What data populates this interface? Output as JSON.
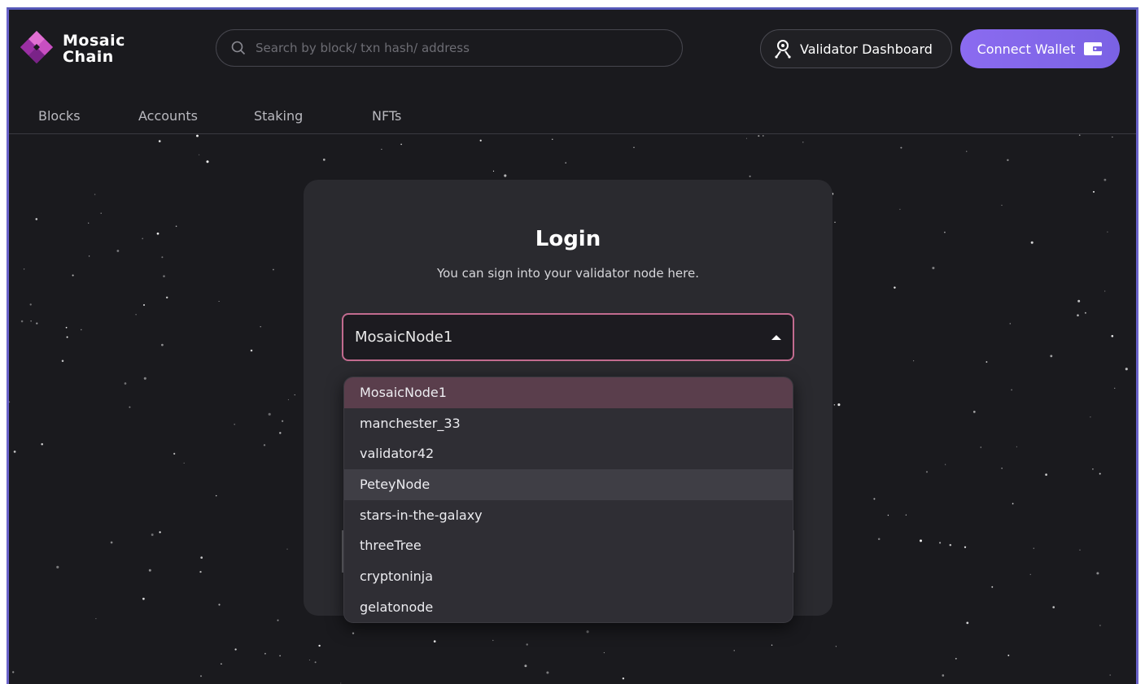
{
  "app": {
    "brand_line1": "Mosaic",
    "brand_line2": "Chain"
  },
  "search": {
    "placeholder": "Search by block/ txn hash/ address"
  },
  "header": {
    "validator_dashboard_label": "Validator Dashboard",
    "connect_wallet_label": "Connect Wallet"
  },
  "nav": {
    "items": [
      "Blocks",
      "Accounts",
      "Staking",
      "NFTs"
    ]
  },
  "login": {
    "title": "Login",
    "subtitle": "You can sign into your validator node here.",
    "selected_node": "MosaicNode1"
  },
  "dropdown": {
    "options": [
      "MosaicNode1",
      "manchester_33",
      "validator42",
      "PeteyNode",
      "stars-in-the-galaxy",
      "threeTree",
      "cryptoninja",
      "gelatonode"
    ],
    "selected_index": 0,
    "hover_index": 3
  },
  "colors": {
    "background": "#1a1a1e",
    "card": "#2a2a2f",
    "accent_purple": "#8b6bf0",
    "select_border": "#c26b8f",
    "selected_option": "#5a3e4c"
  }
}
